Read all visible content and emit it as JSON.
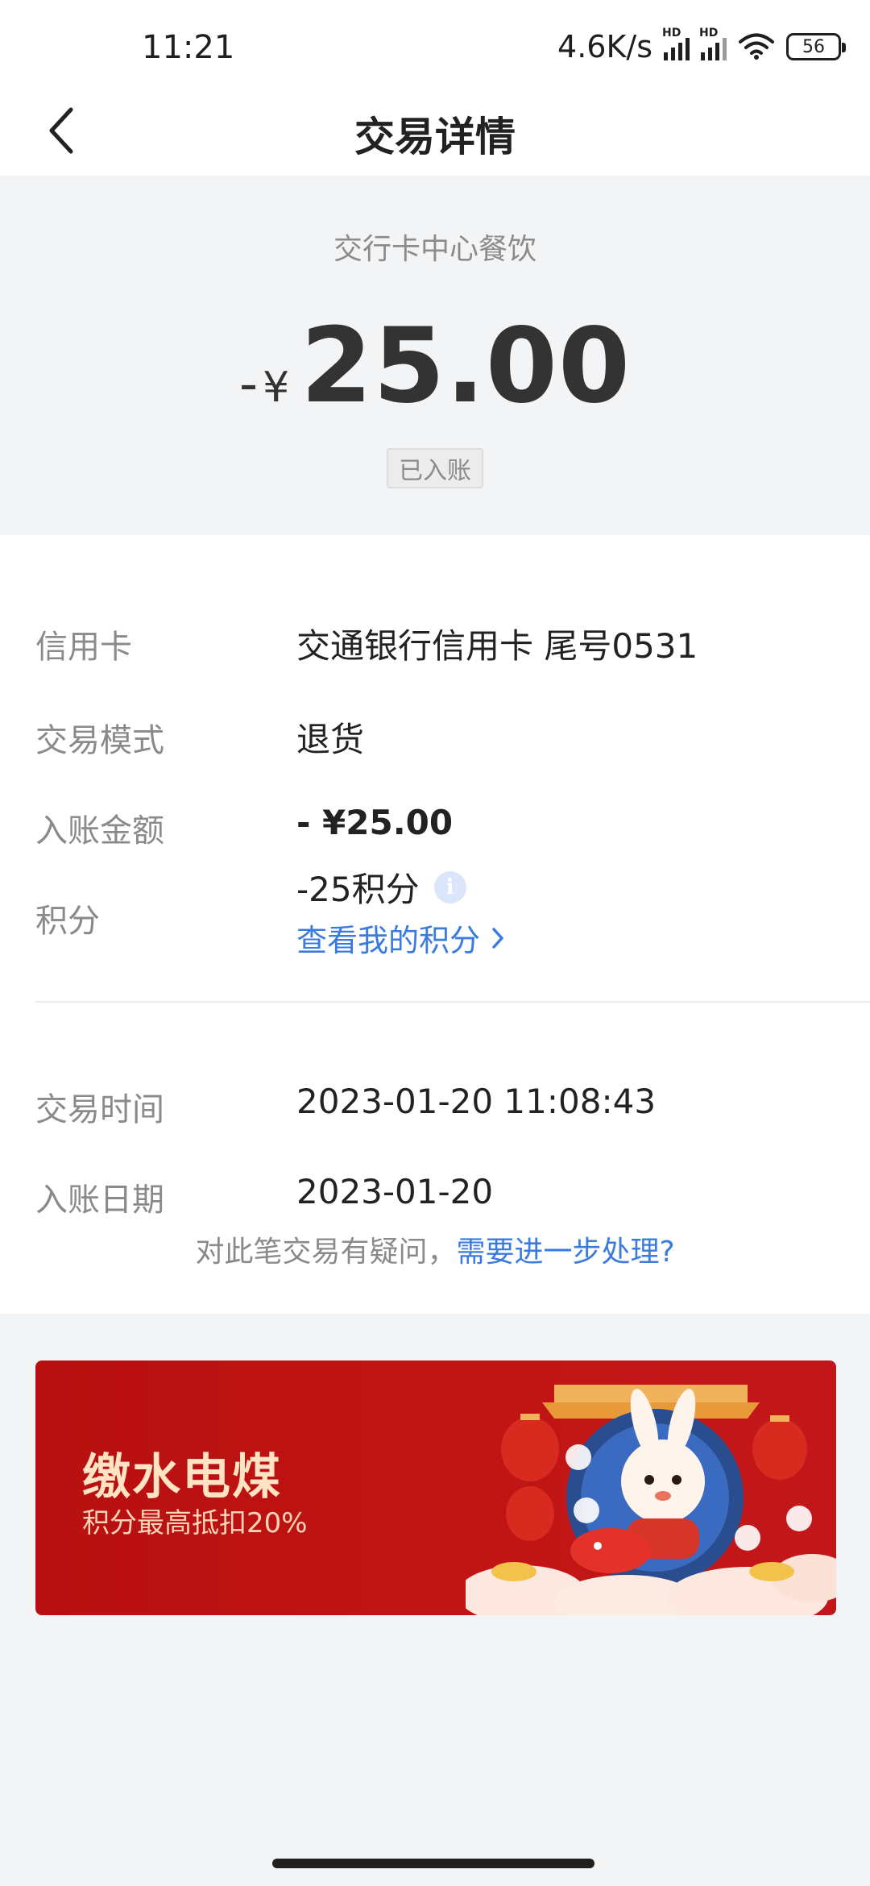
{
  "status_bar": {
    "time": "11:21",
    "net_speed": "4.6K/s",
    "hd_label": "HD",
    "battery": "56"
  },
  "header": {
    "title": "交易详情",
    "back_icon": "chevron-left-icon"
  },
  "summary": {
    "merchant": "交行卡中心餐饮",
    "amount_sign": "-",
    "currency": "¥",
    "amount": "25.00",
    "status": "已入账"
  },
  "details": {
    "card_label": "信用卡",
    "card_value": "交通银行信用卡 尾号0531",
    "mode_label": "交易模式",
    "mode_value": "退货",
    "posted_amount_label": "入账金额",
    "posted_amount_value": "- ¥25.00",
    "points_label": "积分",
    "points_value": "-25积分",
    "points_info_icon": "i",
    "points_link": "查看我的积分",
    "time_label": "交易时间",
    "time_value": "2023-01-20 11:08:43",
    "date_label": "入账日期",
    "date_value": "2023-01-20"
  },
  "dispute": {
    "text": "对此笔交易有疑问，",
    "link": "需要进一步处理?"
  },
  "banner": {
    "title": "缴水电煤",
    "subtitle": "积分最高抵扣20%"
  },
  "colors": {
    "accent_blue": "#3b7be0",
    "banner_red": "#c01514",
    "page_bg": "#f3f4f6"
  }
}
